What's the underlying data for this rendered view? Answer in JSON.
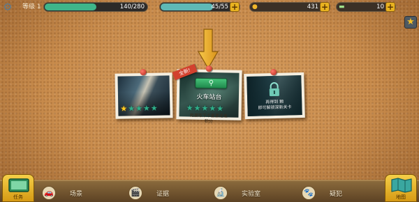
{
  "hud": {
    "level_label": "等级 1",
    "level_progress": "140/280",
    "level_fraction": 0.5,
    "energy_value": "45/55",
    "energy_fraction": 0.82,
    "coins_value": "431",
    "cash_value": "10"
  },
  "cards": [
    {
      "name": "case-1",
      "stars_earned": 1,
      "stars_total": 5
    },
    {
      "name": "case-2",
      "ribbon": "全新!",
      "title": "火车站台",
      "hint": "距赢取下个星星还差\n积分",
      "stars_earned": 0,
      "stars_total": 5
    },
    {
      "name": "case-3",
      "lock_text": "再得到   颗\n即可解锁深新关卡"
    }
  ],
  "bottom_nav": {
    "left_corner_label": "任务",
    "items": [
      {
        "label": "场景",
        "icon": "car-icon"
      },
      {
        "label": "证据",
        "icon": "clapper-icon"
      },
      {
        "label": "实验室",
        "icon": "microscope-icon"
      },
      {
        "label": "疑犯",
        "icon": "paw-icon"
      }
    ],
    "right_corner_label": "地图"
  },
  "colors": {
    "level_bar": "#3fb58a",
    "energy_bar": "#5fb9b6",
    "accent_gold": "#e9b320",
    "star_active": "#ffcc22",
    "star_inactive": "#2fae8a",
    "ribbon_red": "#d2412e"
  }
}
